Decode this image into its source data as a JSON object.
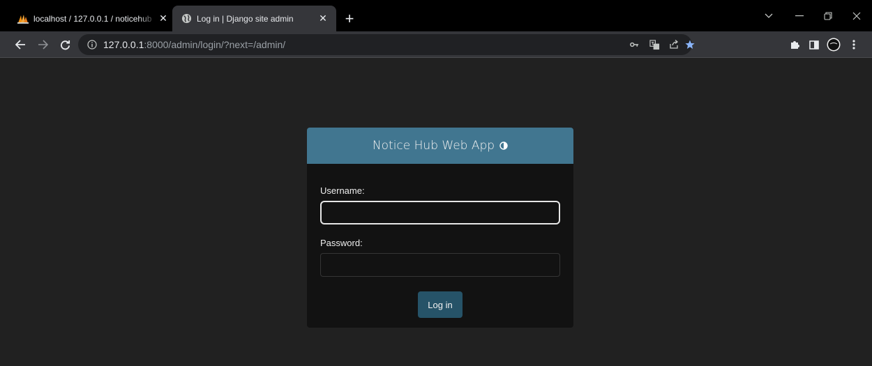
{
  "browser": {
    "tabs": [
      {
        "title": "localhost / 127.0.0.1 / noticehub",
        "favicon": "phpmyadmin-icon",
        "active": false
      },
      {
        "title": "Log in | Django site admin",
        "favicon": "globe-icon",
        "active": true
      }
    ],
    "close_glyph": "✕",
    "new_tab_glyph": "+",
    "url": {
      "host": "127.0.0.1",
      "rest": ":8000/admin/login/?next=/admin/"
    }
  },
  "login": {
    "brand": "Notice Hub Web App",
    "username_label": "Username:",
    "username_value": "",
    "password_label": "Password:",
    "password_value": "",
    "submit_label": "Log in"
  },
  "colors": {
    "header_bg": "#417690",
    "button_bg": "#265368",
    "page_bg": "#212121",
    "card_bg": "#121212",
    "bookmark_star": "#8ab4f8"
  }
}
